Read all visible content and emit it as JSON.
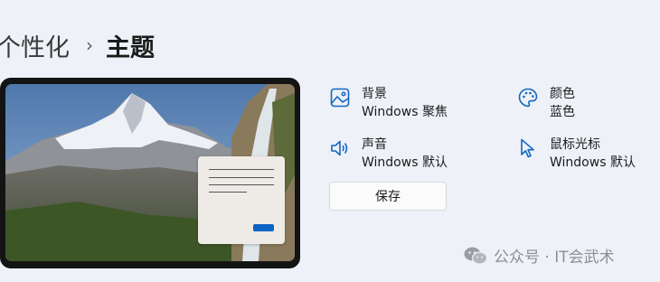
{
  "breadcrumb": {
    "parent": "个性化",
    "separator": "›",
    "current": "主题"
  },
  "preview": {},
  "settings": [
    {
      "label": "背景",
      "value": "Windows 聚焦",
      "icon": "image-icon"
    },
    {
      "label": "颜色",
      "value": "蓝色",
      "icon": "palette-icon"
    },
    {
      "label": "声音",
      "value": "Windows 默认",
      "icon": "speaker-icon"
    },
    {
      "label": "鼠标光标",
      "value": "Windows 默认",
      "icon": "cursor-icon"
    }
  ],
  "save_button": {
    "label": "保存"
  },
  "watermark": {
    "text": "公众号 · IT会武术",
    "icon": "wechat-icon"
  },
  "colors": {
    "accent": "#0b64c4",
    "background": "#eef1f7"
  }
}
